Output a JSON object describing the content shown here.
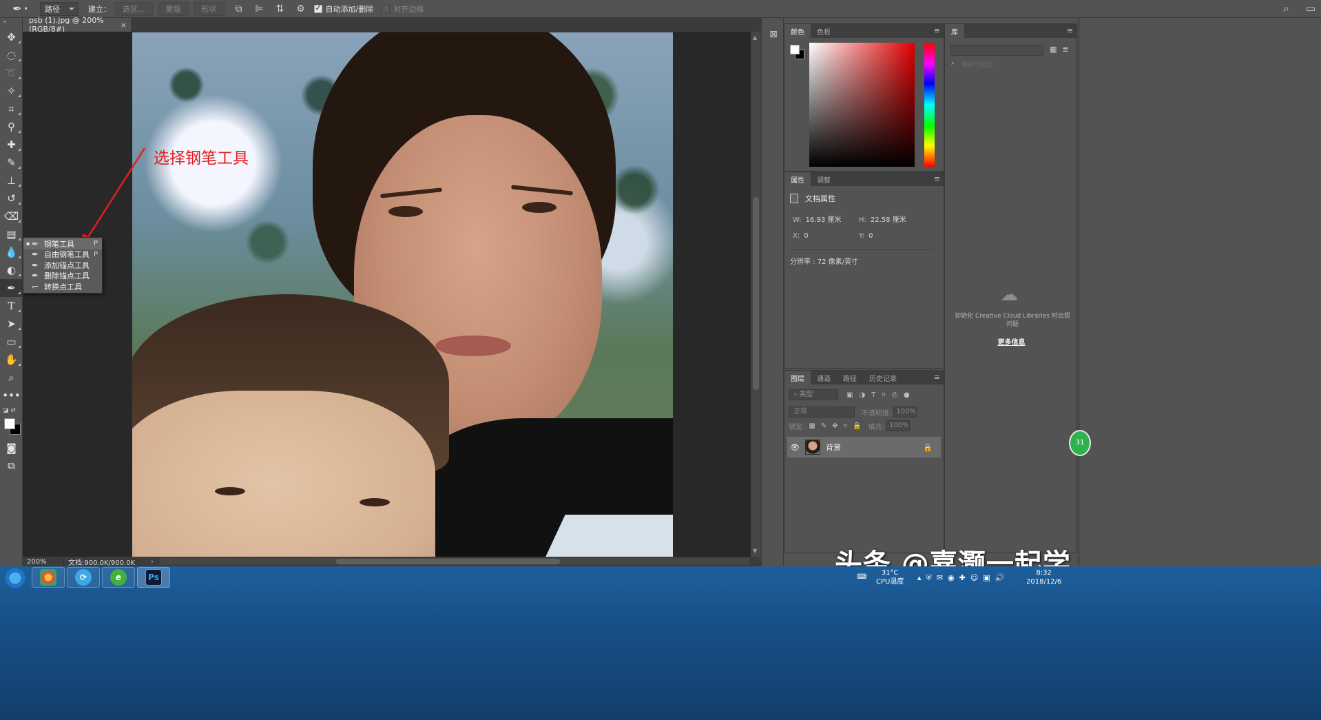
{
  "options_bar": {
    "mode_value": "路径",
    "make_label": "建立：",
    "selection_btn": "选区...",
    "mask_btn": "蒙版",
    "shape_btn": "形状",
    "auto_add_delete": "自动添加/删除",
    "align_edges": "对齐边缘"
  },
  "document": {
    "tab_title": "psb (1).jpg @ 200%(RGB/8#)",
    "tab_close": "×",
    "annotation": "选择钢笔工具"
  },
  "tool_flyout": {
    "items": [
      {
        "label": "钢笔工具",
        "key": "P",
        "selected": true
      },
      {
        "label": "自由钢笔工具",
        "key": "P"
      },
      {
        "label": "添加锚点工具",
        "key": ""
      },
      {
        "label": "删除锚点工具",
        "key": ""
      },
      {
        "label": "转换点工具",
        "key": ""
      }
    ]
  },
  "status_bar": {
    "zoom": "200%",
    "doc_info": "文档:900.0K/900.0K"
  },
  "color_panel": {
    "tabs": [
      "颜色",
      "色板"
    ],
    "fg_color": "#ffffff",
    "bg_color": "#000000"
  },
  "properties_panel": {
    "tabs": [
      "属性",
      "调整"
    ],
    "heading": "文档属性",
    "w_label": "W:",
    "w_value": "16.93 厘米",
    "h_label": "H:",
    "h_value": "22.58 厘米",
    "x_label": "X:",
    "x_value": "0",
    "y_label": "Y:",
    "y_value": "0",
    "resolution": "分辨率 : 72 像素/英寸"
  },
  "layers_panel": {
    "tabs": [
      "图层",
      "通道",
      "路径",
      "历史记录"
    ],
    "filter_placeholder": "类型",
    "blend_mode": "正常",
    "opacity_label": "不透明度:",
    "opacity_value": "100%",
    "lock_label": "锁定:",
    "fill_label": "填充:",
    "fill_value": "100%",
    "layer_name": "背景"
  },
  "library_panel": {
    "tab": "库",
    "search_placeholder": "搜索当前库",
    "message": "初始化 Creative Cloud Libraries 时出现问题",
    "more_info": "更多信息"
  },
  "watermark": "头条 @嘉灏一起学",
  "taskbar": {
    "temp": "31°C",
    "temp_label": "CPU温度",
    "time": "8:32",
    "date": "2018/12/6",
    "ps_label": "Ps"
  }
}
